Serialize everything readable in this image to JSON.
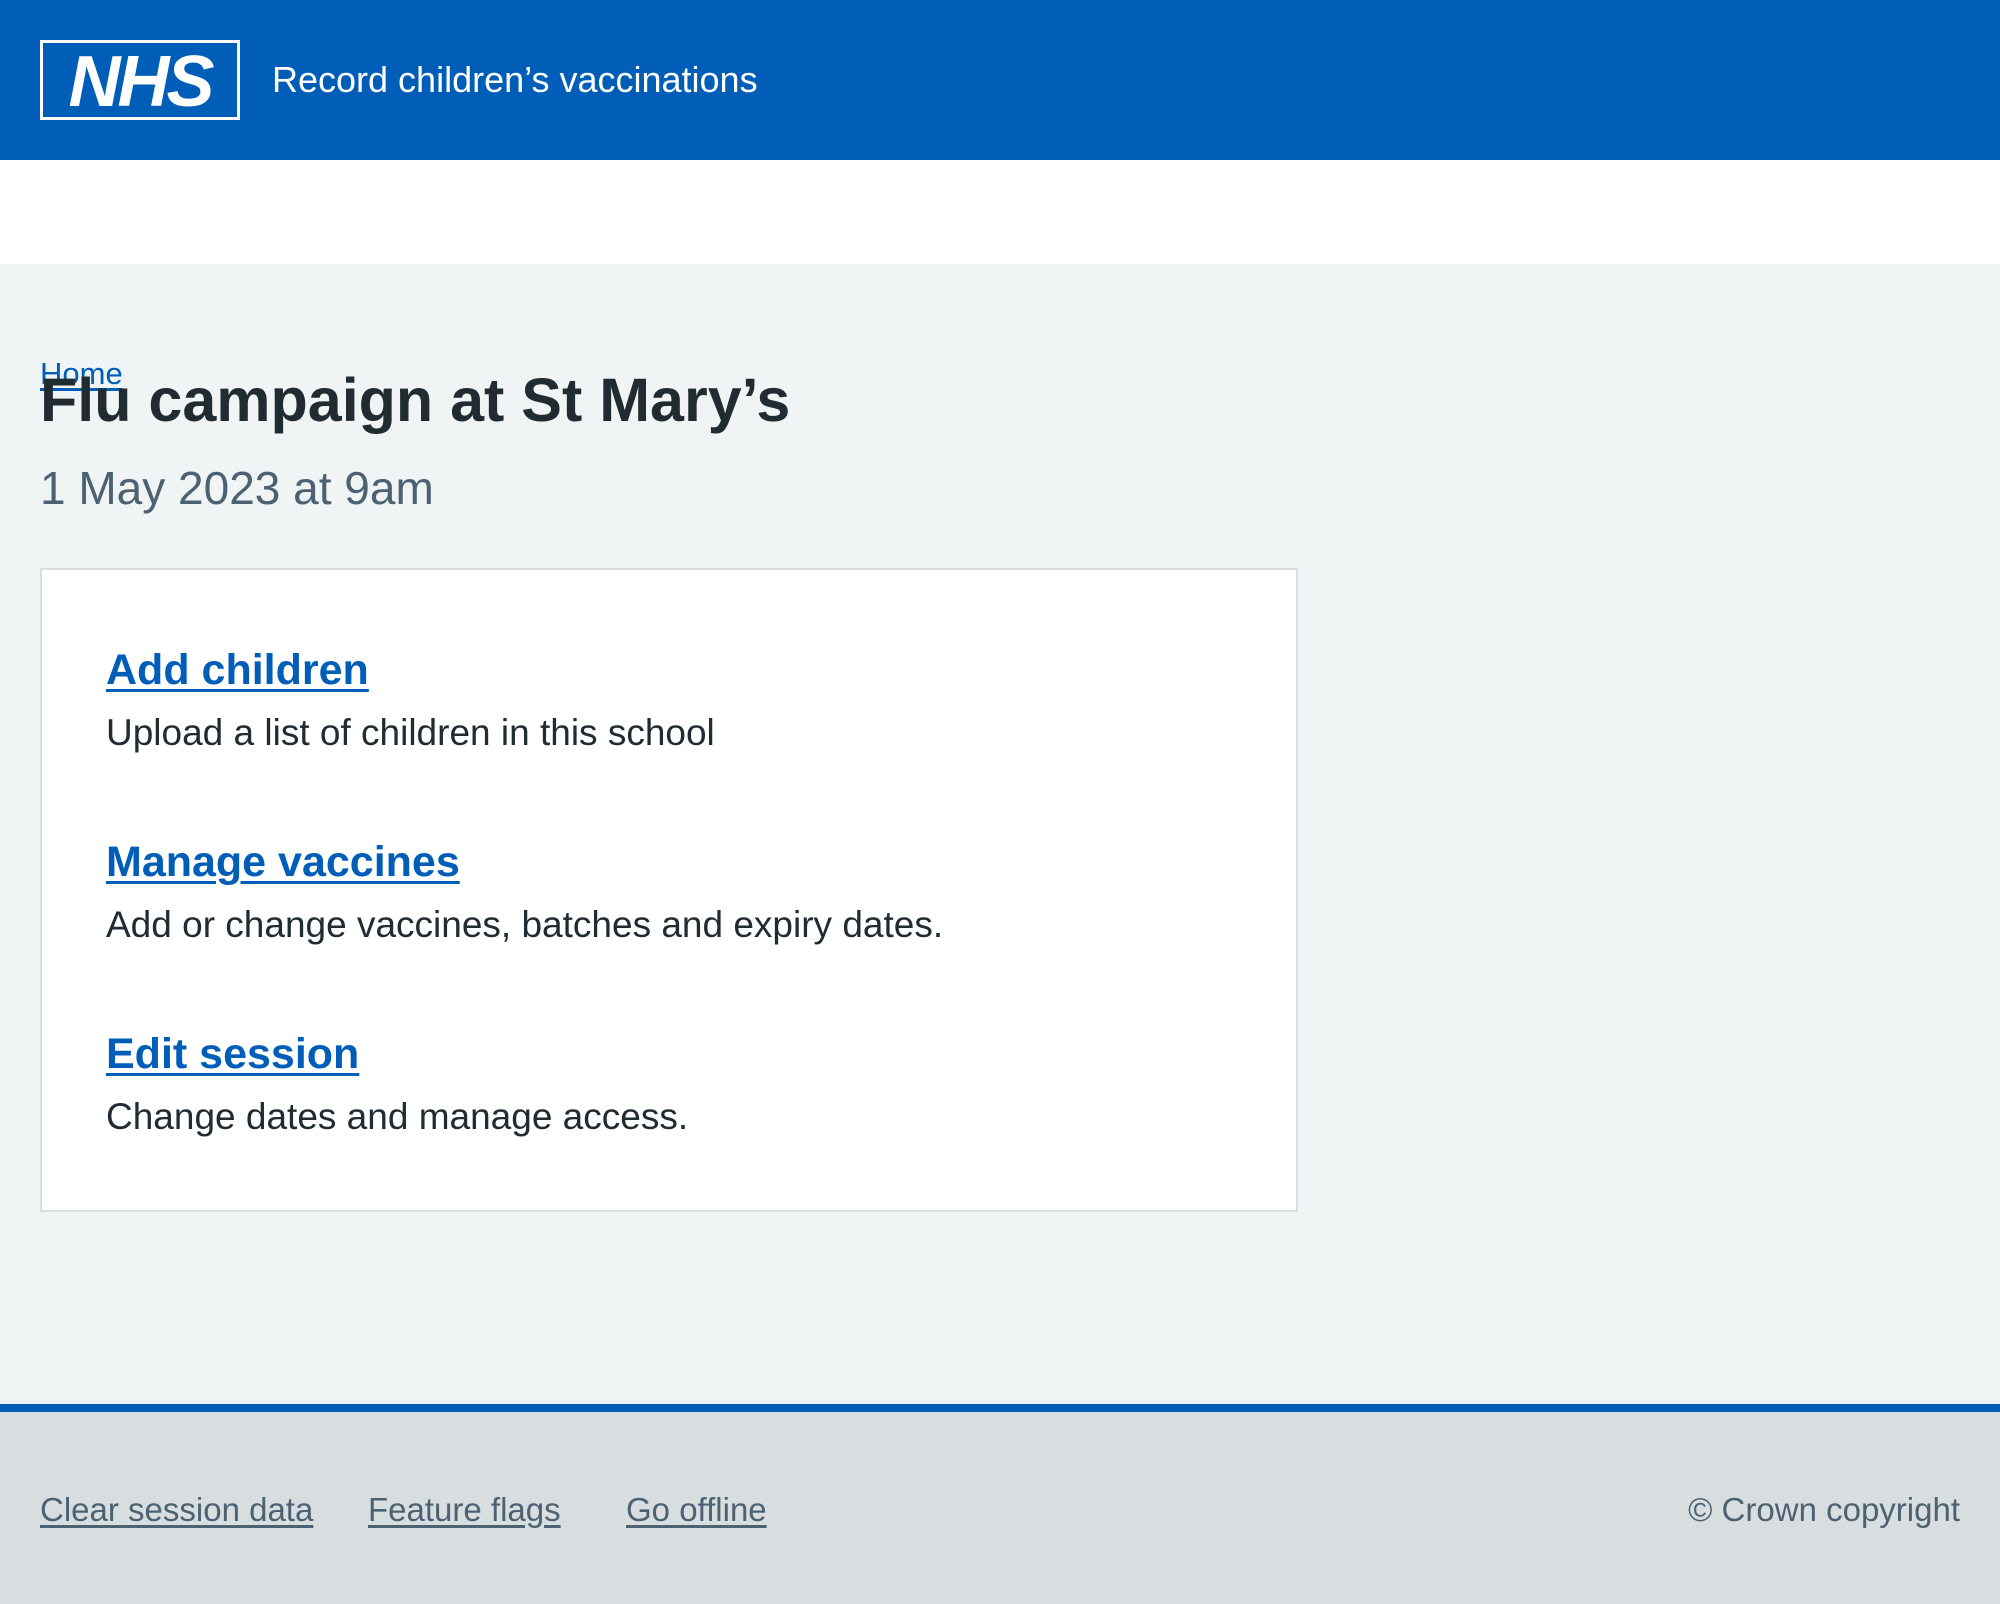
{
  "header": {
    "logo_text": "NHS",
    "service_name": "Record children’s vaccinations"
  },
  "breadcrumb": {
    "home_label": "Home"
  },
  "main": {
    "title": "Flu campaign at St Mary’s",
    "caption": "1 May 2023 at 9am",
    "actions": [
      {
        "label": "Add children",
        "description": "Upload a list of children in this school"
      },
      {
        "label": "Manage vaccines",
        "description": "Add or change vaccines, batches and expiry dates."
      },
      {
        "label": "Edit session",
        "description": "Change dates and manage access."
      }
    ]
  },
  "footer": {
    "links": [
      {
        "label": "Clear session data"
      },
      {
        "label": "Feature flags"
      },
      {
        "label": "Go offline"
      }
    ],
    "copyright": "© Crown copyright"
  },
  "colors": {
    "nhs_blue": "#005eb8",
    "background": "#f0f4f5",
    "text": "#212b32",
    "secondary_text": "#4c6272",
    "footer_bg": "#d8dde0",
    "border": "#d8dde0"
  }
}
